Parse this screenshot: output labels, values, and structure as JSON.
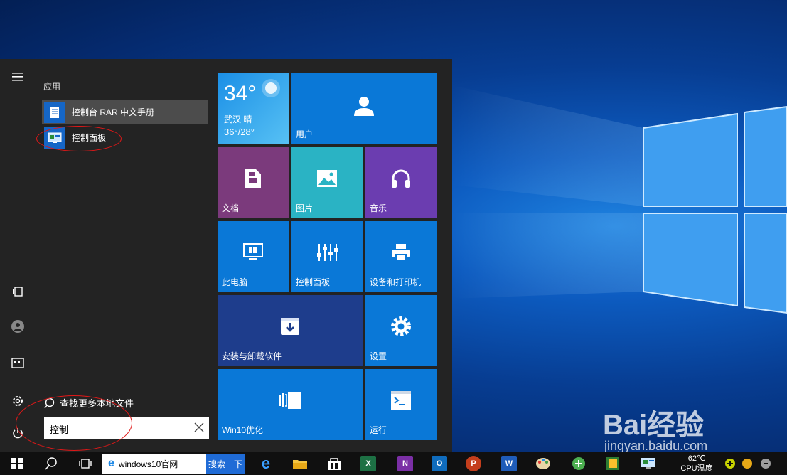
{
  "desktop": {
    "watermark_brand": "Bai经验",
    "watermark_url": "jingyan.baidu.com"
  },
  "start_menu": {
    "results": {
      "section_heading": "应用",
      "apps": [
        {
          "label": "控制台 RAR 中文手册"
        },
        {
          "label": "控制面板"
        }
      ],
      "more_files": "查找更多本地文件",
      "search_value": "控制"
    },
    "tiles": {
      "weather": {
        "temp": "34°",
        "city": "武汉  晴",
        "range": "36°/28°"
      },
      "user": "用户",
      "documents": "文档",
      "pictures": "图片",
      "music": "音乐",
      "this_pc": "此电脑",
      "control_panel": "控制面板",
      "devices_printers": "设备和打印机",
      "install_uninstall": "安装与卸载软件",
      "settings": "设置",
      "win10_optimize": "Win10优化",
      "run": "运行"
    }
  },
  "taskbar": {
    "address": "windows10官网",
    "search_button": "搜索一下",
    "apps": [
      "X",
      "N",
      "O",
      "P",
      "W"
    ],
    "cpu_temp": "62℃",
    "cpu_label": "CPU温度"
  },
  "colors": {
    "tile_blue": "#0a78d7",
    "tile_purple": "#7b3a7c",
    "tile_teal": "#2ab3c4",
    "tile_violet": "#6b3db0",
    "tile_navy": "#1e3d8c",
    "weather_light": "#47b4ef",
    "annotation_red": "#e01818"
  }
}
